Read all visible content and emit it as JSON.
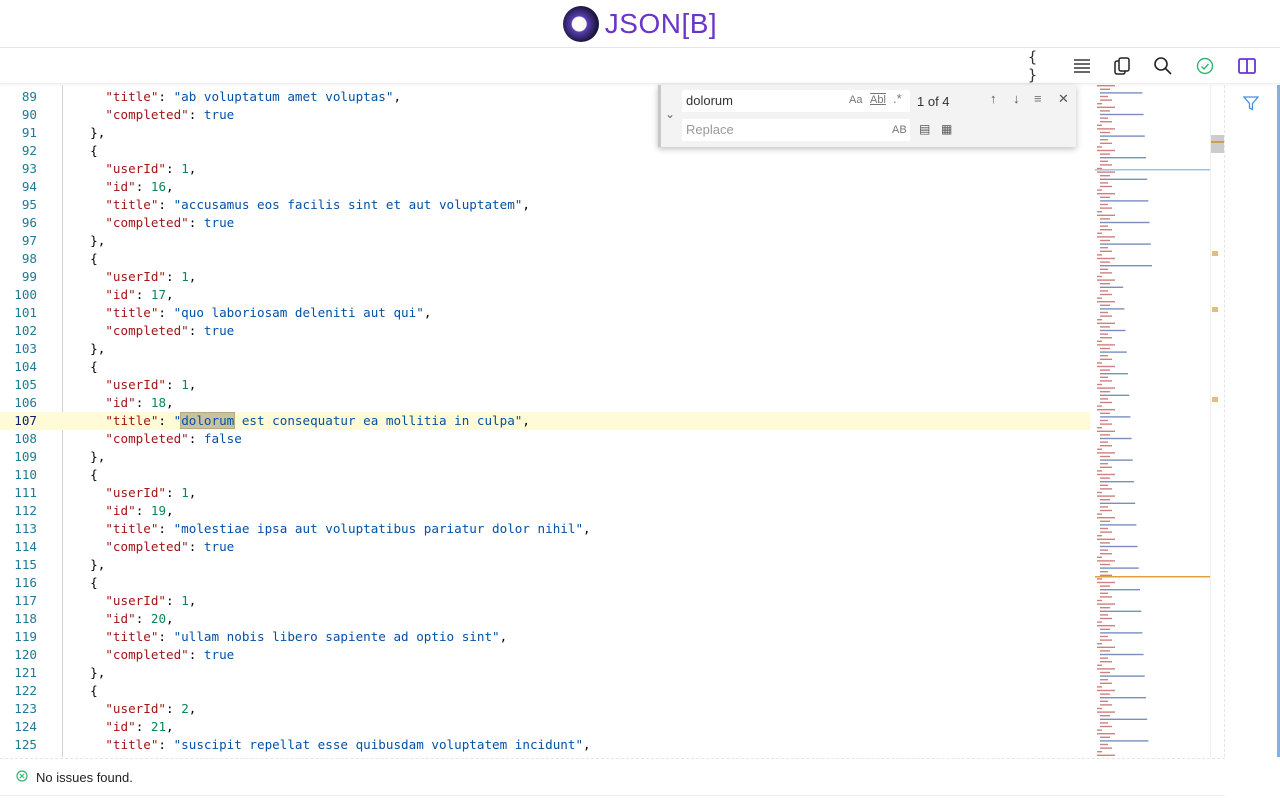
{
  "header": {
    "logo_text": "JSON[B]"
  },
  "toolbar": {
    "icons": [
      "braces-icon",
      "list-icon",
      "copy-icon",
      "search-icon",
      "check-circle-icon",
      "split-view-icon"
    ],
    "accent": "#6b35c9"
  },
  "find": {
    "query": "dolorum",
    "replace_placeholder": "Replace",
    "match_count": "1 of 4",
    "opt_case": "Aa",
    "opt_word": "Abl",
    "opt_regex": ".*",
    "opt_preserve": "AB"
  },
  "editor": {
    "current_line": 107,
    "lines": [
      {
        "n": 89,
        "t": "    \"title\": \"ab voluptatum amet voluptas\","
      },
      {
        "n": 90,
        "t": "    \"completed\": true"
      },
      {
        "n": 91,
        "t": "  },"
      },
      {
        "n": 92,
        "t": "  {"
      },
      {
        "n": 93,
        "t": "    \"userId\": 1,"
      },
      {
        "n": 94,
        "t": "    \"id\": 16,"
      },
      {
        "n": 95,
        "t": "    \"title\": \"accusamus eos facilis sint et aut voluptatem\","
      },
      {
        "n": 96,
        "t": "    \"completed\": true"
      },
      {
        "n": 97,
        "t": "  },"
      },
      {
        "n": 98,
        "t": "  {"
      },
      {
        "n": 99,
        "t": "    \"userId\": 1,"
      },
      {
        "n": 100,
        "t": "    \"id\": 17,"
      },
      {
        "n": 101,
        "t": "    \"title\": \"quo laboriosam deleniti aut qui\","
      },
      {
        "n": 102,
        "t": "    \"completed\": true"
      },
      {
        "n": 103,
        "t": "  },"
      },
      {
        "n": 104,
        "t": "  {"
      },
      {
        "n": 105,
        "t": "    \"userId\": 1,"
      },
      {
        "n": 106,
        "t": "    \"id\": 18,"
      },
      {
        "n": 107,
        "t": "    \"title\": \"dolorum est consequatur ea mollitia in culpa\","
      },
      {
        "n": 108,
        "t": "    \"completed\": false"
      },
      {
        "n": 109,
        "t": "  },"
      },
      {
        "n": 110,
        "t": "  {"
      },
      {
        "n": 111,
        "t": "    \"userId\": 1,"
      },
      {
        "n": 112,
        "t": "    \"id\": 19,"
      },
      {
        "n": 113,
        "t": "    \"title\": \"molestiae ipsa aut voluptatibus pariatur dolor nihil\","
      },
      {
        "n": 114,
        "t": "    \"completed\": true"
      },
      {
        "n": 115,
        "t": "  },"
      },
      {
        "n": 116,
        "t": "  {"
      },
      {
        "n": 117,
        "t": "    \"userId\": 1,"
      },
      {
        "n": 118,
        "t": "    \"id\": 20,"
      },
      {
        "n": 119,
        "t": "    \"title\": \"ullam nobis libero sapiente ad optio sint\","
      },
      {
        "n": 120,
        "t": "    \"completed\": true"
      },
      {
        "n": 121,
        "t": "  },"
      },
      {
        "n": 122,
        "t": "  {"
      },
      {
        "n": 123,
        "t": "    \"userId\": 2,"
      },
      {
        "n": 124,
        "t": "    \"id\": 21,"
      },
      {
        "n": 125,
        "t": "    \"title\": \"suscipit repellat esse quibusdam voluptatem incidunt\","
      }
    ]
  },
  "status": {
    "message": "No issues found.",
    "color": "#2bb673"
  }
}
